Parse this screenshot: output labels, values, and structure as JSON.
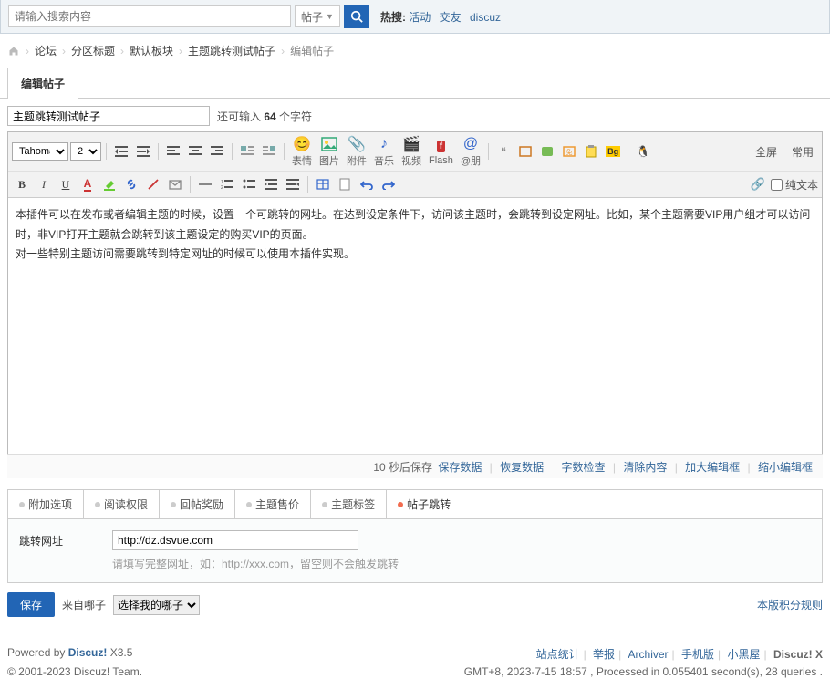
{
  "search": {
    "placeholder": "请输入搜索内容",
    "dropdown": "帖子",
    "hot_label": "热搜:",
    "hot_links": [
      "活动",
      "交友",
      "discuz"
    ]
  },
  "breadcrumb": {
    "items": [
      "论坛",
      "分区标题",
      "默认板块",
      "主题跳转测试帖子",
      "编辑帖子"
    ]
  },
  "page_tab": "编辑帖子",
  "title_value": "主题跳转测试帖子",
  "char_hint_prefix": "还可输入 ",
  "char_hint_count": "64",
  "char_hint_suffix": " 个字符",
  "toolbar": {
    "font_family": "Tahoma",
    "font_size": "2",
    "groups": {
      "emoji": "表情",
      "image": "图片",
      "attach": "附件",
      "music": "音乐",
      "video": "视频",
      "flash": "Flash",
      "at": "@朋"
    },
    "fullscreen": "全屏",
    "common": "常用",
    "plaintext": "纯文本"
  },
  "editor_body": {
    "p1": "本插件可以在发布或者编辑主题的时候，设置一个可跳转的网址。在达到设定条件下，访问该主题时，会跳转到设定网址。比如，某个主题需要VIP用户组才可以访问时，非VIP打开主题就会跳转到该主题设定的购买VIP的页面。",
    "p2": "对一些特别主题访问需要跳转到特定网址的时候可以使用本插件实现。"
  },
  "autosave": {
    "countdown": "10 秒后保存",
    "save_now": "保存数据",
    "restore": "恢复数据",
    "spellcheck": "字数检查",
    "clear": "清除内容",
    "expand": "加大编辑框",
    "shrink": "缩小编辑框"
  },
  "opt_tabs": [
    "附加选项",
    "阅读权限",
    "回帖奖励",
    "主题售价",
    "主题标签",
    "帖子跳转"
  ],
  "redirect": {
    "label": "跳转网址",
    "value": "http://dz.dsvue.com",
    "hint": "请填写完整网址，如：http://xxx.com，留空则不会触发跳转"
  },
  "actions": {
    "save": "保存",
    "source_label": "来自哪子",
    "source_value": "选择我的哪子",
    "credit_rules": "本版积分规则"
  },
  "footer": {
    "powered_prefix": "Powered by ",
    "powered_link": "Discuz!",
    "powered_ver": " X3.5",
    "copyright": "© 2001-2023 Discuz! Team.",
    "links": [
      "站点统计",
      "举报",
      "Archiver",
      "手机版",
      "小黑屋"
    ],
    "brand": "Discuz! X",
    "timing": "GMT+8, 2023-7-15 18:57 , Processed in 0.055401 second(s), 28 queries ."
  }
}
